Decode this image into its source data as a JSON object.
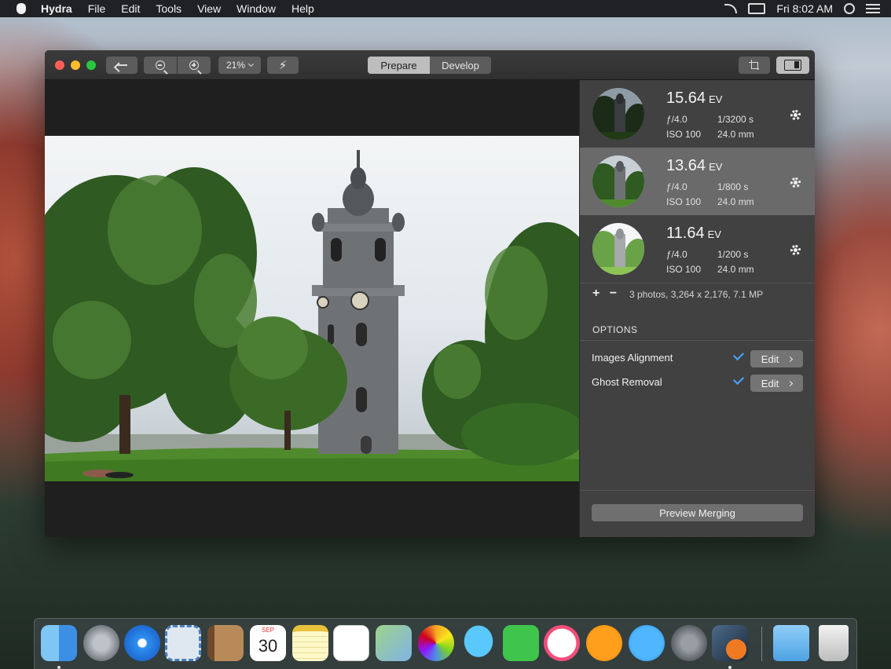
{
  "menubar": {
    "app_name": "Hydra",
    "items": [
      "File",
      "Edit",
      "Tools",
      "View",
      "Window",
      "Help"
    ],
    "clock": "Fri 8:02 AM"
  },
  "toolbar": {
    "zoom_level": "21%",
    "tabs": [
      {
        "label": "Prepare",
        "active": true
      },
      {
        "label": "Develop",
        "active": false
      }
    ]
  },
  "brackets": [
    {
      "ev": "15.64",
      "ev_unit": "EV",
      "aperture": "ƒ/4.0",
      "shutter": "1/3200 s",
      "iso": "ISO 100",
      "focal": "24.0 mm",
      "selected": false
    },
    {
      "ev": "13.64",
      "ev_unit": "EV",
      "aperture": "ƒ/4.0",
      "shutter": "1/800 s",
      "iso": "ISO 100",
      "focal": "24.0 mm",
      "selected": true
    },
    {
      "ev": "11.64",
      "ev_unit": "EV",
      "aperture": "ƒ/4.0",
      "shutter": "1/200 s",
      "iso": "ISO 100",
      "focal": "24.0 mm",
      "selected": false
    }
  ],
  "photo_controls": {
    "add": "+",
    "remove": "−",
    "summary": "3 photos, 3,264 x 2,176, 7.1 MP"
  },
  "options": {
    "title": "OPTIONS",
    "items": [
      {
        "label": "Images Alignment",
        "checked": true,
        "button": "Edit"
      },
      {
        "label": "Ghost Removal",
        "checked": true,
        "button": "Edit"
      }
    ]
  },
  "preview_button": "Preview Merging",
  "dock": {
    "calendar_month": "SEP",
    "calendar_day": "30",
    "apps": [
      "finder-icon",
      "launchpad-icon",
      "safari-icon",
      "mail-icon",
      "contacts-icon",
      "calendar-icon",
      "notes-icon",
      "reminders-icon",
      "maps-icon",
      "photos-icon",
      "messages-icon",
      "facetime-icon",
      "itunes-icon",
      "ibooks-icon",
      "app-store-icon",
      "system-preferences-icon",
      "hydra-icon",
      "downloads-folder-icon",
      "trash-icon"
    ]
  }
}
